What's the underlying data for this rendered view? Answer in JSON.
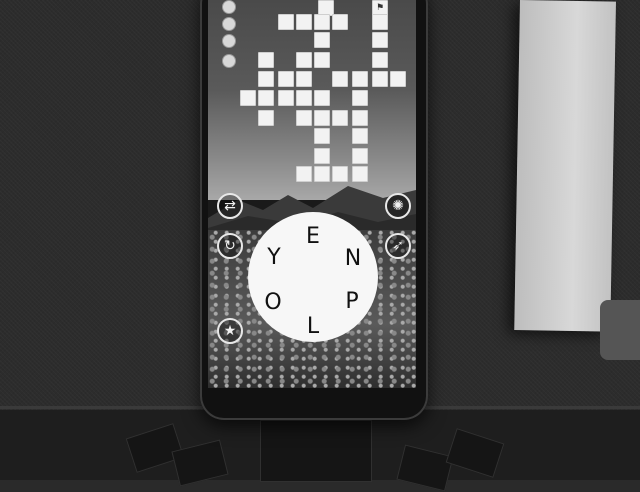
{
  "game": {
    "wheel_letters": [
      "E",
      "N",
      "P",
      "L",
      "O",
      "Y"
    ],
    "buttons": {
      "shuffle": "shuffle-icon",
      "hint": "lightbulb-icon",
      "refresh": "restart-icon",
      "rocket": "rocket-icon",
      "star": "star-icon"
    },
    "colors": {
      "tile": "#f2f2f2",
      "wheel": "#f7f7f7"
    }
  }
}
